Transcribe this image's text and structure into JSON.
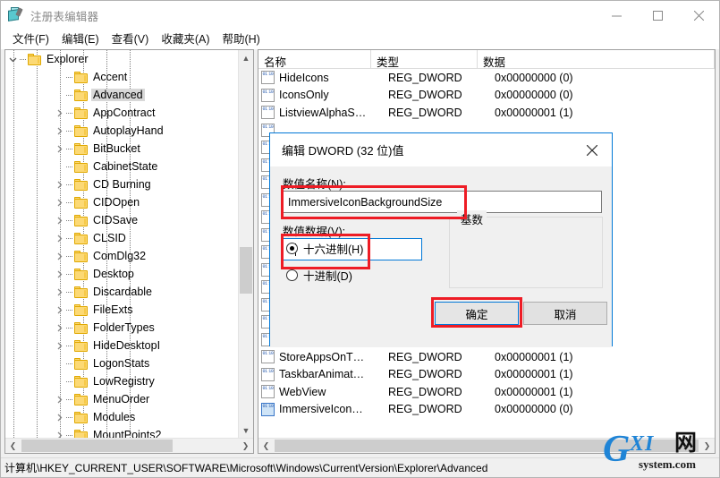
{
  "window": {
    "title": "注册表编辑器",
    "app_icon": "registry-editor-icon",
    "minimize_label": "最小化",
    "maximize_label": "最大化",
    "close_label": "关闭"
  },
  "menubar": {
    "items": [
      {
        "label": "文件(F)"
      },
      {
        "label": "编辑(E)"
      },
      {
        "label": "查看(V)"
      },
      {
        "label": "收藏夹(A)"
      },
      {
        "label": "帮助(H)"
      }
    ]
  },
  "tree": {
    "nodes": [
      {
        "label": "Explorer",
        "indent": 0,
        "expander": "expanded",
        "selected": false
      },
      {
        "label": "Accent",
        "indent": 1,
        "expander": "none",
        "selected": false
      },
      {
        "label": "Advanced",
        "indent": 1,
        "expander": "none",
        "selected": true
      },
      {
        "label": "AppContract",
        "indent": 1,
        "expander": "collapsed",
        "selected": false
      },
      {
        "label": "AutoplayHand",
        "indent": 1,
        "expander": "collapsed",
        "selected": false
      },
      {
        "label": "BitBucket",
        "indent": 1,
        "expander": "collapsed",
        "selected": false
      },
      {
        "label": "CabinetState",
        "indent": 1,
        "expander": "none",
        "selected": false
      },
      {
        "label": "CD Burning",
        "indent": 1,
        "expander": "collapsed",
        "selected": false
      },
      {
        "label": "CIDOpen",
        "indent": 1,
        "expander": "collapsed",
        "selected": false
      },
      {
        "label": "CIDSave",
        "indent": 1,
        "expander": "collapsed",
        "selected": false
      },
      {
        "label": "CLSID",
        "indent": 1,
        "expander": "collapsed",
        "selected": false
      },
      {
        "label": "ComDlg32",
        "indent": 1,
        "expander": "collapsed",
        "selected": false
      },
      {
        "label": "Desktop",
        "indent": 1,
        "expander": "collapsed",
        "selected": false
      },
      {
        "label": "Discardable",
        "indent": 1,
        "expander": "collapsed",
        "selected": false
      },
      {
        "label": "FileExts",
        "indent": 1,
        "expander": "collapsed",
        "selected": false
      },
      {
        "label": "FolderTypes",
        "indent": 1,
        "expander": "collapsed",
        "selected": false
      },
      {
        "label": "HideDesktopI",
        "indent": 1,
        "expander": "collapsed",
        "selected": false
      },
      {
        "label": "LogonStats",
        "indent": 1,
        "expander": "none",
        "selected": false
      },
      {
        "label": "LowRegistry",
        "indent": 1,
        "expander": "none",
        "selected": false
      },
      {
        "label": "MenuOrder",
        "indent": 1,
        "expander": "collapsed",
        "selected": false
      },
      {
        "label": "Modules",
        "indent": 1,
        "expander": "collapsed",
        "selected": false
      },
      {
        "label": "MountPoints2",
        "indent": 1,
        "expander": "collapsed",
        "selected": false
      }
    ]
  },
  "list": {
    "columns": [
      "名称",
      "类型",
      "数据"
    ],
    "rows": [
      {
        "name": "HideIcons",
        "type": "REG_DWORD",
        "data": "0x00000000 (0)",
        "icon_highlighted": false,
        "hidden_by_dialog": false
      },
      {
        "name": "IconsOnly",
        "type": "REG_DWORD",
        "data": "0x00000000 (0)",
        "icon_highlighted": false,
        "hidden_by_dialog": false
      },
      {
        "name": "ListviewAlphaS…",
        "type": "REG_DWORD",
        "data": "0x00000001 (1)",
        "icon_highlighted": false,
        "hidden_by_dialog": false
      },
      {
        "name": "",
        "type": "",
        "data": "",
        "icon_highlighted": false,
        "hidden_by_dialog": true
      },
      {
        "name": "",
        "type": "",
        "data": "",
        "icon_highlighted": false,
        "hidden_by_dialog": true
      },
      {
        "name": "",
        "type": "",
        "data": "",
        "icon_highlighted": false,
        "hidden_by_dialog": true
      },
      {
        "name": "",
        "type": "",
        "data": "",
        "icon_highlighted": false,
        "hidden_by_dialog": true
      },
      {
        "name": "",
        "type": "",
        "data": "",
        "icon_highlighted": false,
        "hidden_by_dialog": true
      },
      {
        "name": "",
        "type": "",
        "data": "",
        "icon_highlighted": false,
        "hidden_by_dialog": true
      },
      {
        "name": "",
        "type": "",
        "data": "",
        "icon_highlighted": false,
        "hidden_by_dialog": true
      },
      {
        "name": "",
        "type": "",
        "data": "",
        "icon_highlighted": false,
        "hidden_by_dialog": true
      },
      {
        "name": "",
        "type": "",
        "data": "",
        "icon_highlighted": false,
        "hidden_by_dialog": true
      },
      {
        "name": "",
        "type": "",
        "data": "",
        "icon_highlighted": false,
        "hidden_by_dialog": true
      },
      {
        "name": "",
        "type": "",
        "data": "",
        "icon_highlighted": false,
        "hidden_by_dialog": true
      },
      {
        "name": "",
        "type": "",
        "data": "",
        "icon_highlighted": false,
        "hidden_by_dialog": true
      },
      {
        "name": "",
        "type": "",
        "data": "",
        "icon_highlighted": false,
        "hidden_by_dialog": true
      },
      {
        "name": "StoreAppsOnT…",
        "type": "REG_DWORD",
        "data": "0x00000001 (1)",
        "icon_highlighted": false,
        "hidden_by_dialog": false
      },
      {
        "name": "TaskbarAnimat…",
        "type": "REG_DWORD",
        "data": "0x00000001 (1)",
        "icon_highlighted": false,
        "hidden_by_dialog": false
      },
      {
        "name": "WebView",
        "type": "REG_DWORD",
        "data": "0x00000001 (1)",
        "icon_highlighted": false,
        "hidden_by_dialog": false
      },
      {
        "name": "ImmersiveIcon…",
        "type": "REG_DWORD",
        "data": "0x00000000 (0)",
        "icon_highlighted": true,
        "hidden_by_dialog": false
      }
    ]
  },
  "dialog": {
    "title": "编辑 DWORD (32 位)值",
    "close_icon": "close-icon",
    "value_name_label": "数值名称(N):",
    "value_name": "ImmersiveIconBackgroundSize",
    "value_data_label": "数值数据(V):",
    "value_data": "1",
    "radix_legend": "基数",
    "radix_options": [
      {
        "label": "十六进制(H)",
        "selected": true
      },
      {
        "label": "十进制(D)",
        "selected": false
      }
    ],
    "ok_label": "确定",
    "cancel_label": "取消"
  },
  "statusbar": {
    "path": "计算机\\HKEY_CURRENT_USER\\SOFTWARE\\Microsoft\\Windows\\CurrentVersion\\Explorer\\Advanced"
  },
  "watermark": {
    "g": "G",
    "xi": "XI",
    "wang": "网",
    "domain": "system.com"
  },
  "colors": {
    "accent": "#0078d7",
    "annotation": "#ee1c25",
    "folder": "#fcd975",
    "selection": "#d8d8d8"
  }
}
